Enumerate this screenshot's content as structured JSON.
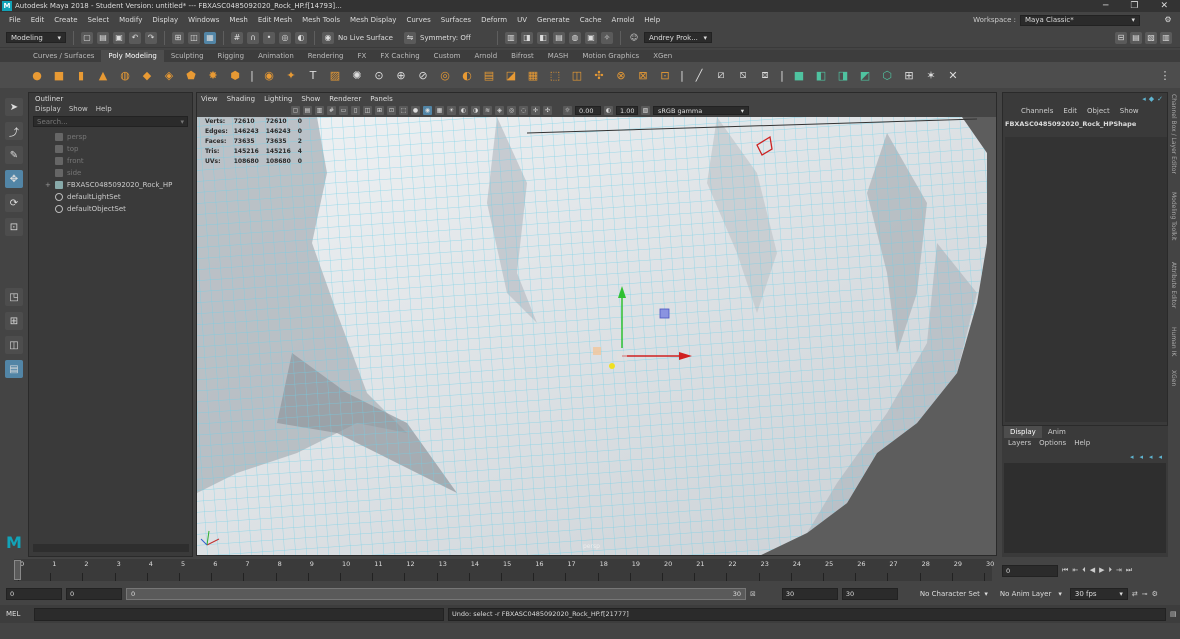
{
  "titlebar": {
    "title": "Autodesk Maya 2018 - Student Version: untitled*   ---   FBXASC0485092020_Rock_HP.f[14793]...",
    "controls": [
      "─",
      "❐",
      "✕"
    ]
  },
  "menubar": {
    "items": [
      "File",
      "Edit",
      "Create",
      "Select",
      "Modify",
      "Display",
      "Windows",
      "Mesh",
      "Edit Mesh",
      "Mesh Tools",
      "Mesh Display",
      "Curves",
      "Surfaces",
      "Deform",
      "UV",
      "Generate",
      "Cache",
      "Arnold",
      "Help"
    ],
    "workspace_label": "Workspace :",
    "workspace_value": "Maya Classic*"
  },
  "statusline": {
    "mode": "Modeling",
    "live_surface": "No Live Surface",
    "symmetry": "Symmetry: Off",
    "user": "Andrey Prok..."
  },
  "shelf": {
    "tabs": [
      "Curves / Surfaces",
      "Poly Modeling",
      "Sculpting",
      "Rigging",
      "Animation",
      "Rendering",
      "FX",
      "FX Caching",
      "Custom",
      "Arnold",
      "Bifrost",
      "MASH",
      "Motion Graphics",
      "XGen"
    ],
    "active_tab": "Poly Modeling"
  },
  "outliner": {
    "title": "Outliner",
    "menus": [
      "Display",
      "Show",
      "Help"
    ],
    "search_placeholder": "Search...",
    "items": [
      {
        "label": "persp",
        "dim": true
      },
      {
        "label": "top",
        "dim": true
      },
      {
        "label": "front",
        "dim": true
      },
      {
        "label": "side",
        "dim": true
      },
      {
        "label": "FBXASC0485092020_Rock_HP",
        "dim": false
      },
      {
        "label": "defaultLightSet",
        "dim": false
      },
      {
        "label": "defaultObjectSet",
        "dim": false
      }
    ]
  },
  "viewport": {
    "menus": [
      "View",
      "Shading",
      "Lighting",
      "Show",
      "Renderer",
      "Panels"
    ],
    "exposure": "0.00",
    "gamma": "1.00",
    "color_space": "sRGB gamma",
    "hud": [
      {
        "label": "Verts:",
        "a": "72610",
        "b": "72610",
        "c": "0"
      },
      {
        "label": "Edges:",
        "a": "146243",
        "b": "146243",
        "c": "0"
      },
      {
        "label": "Faces:",
        "a": "73635",
        "b": "73635",
        "c": "2"
      },
      {
        "label": "Tris:",
        "a": "145216",
        "b": "145216",
        "c": "4"
      },
      {
        "label": "UVs:",
        "a": "108680",
        "b": "108680",
        "c": "0"
      }
    ],
    "camera_label": "persp"
  },
  "channelbox": {
    "menus": [
      "Channels",
      "Edit",
      "Object",
      "Show"
    ],
    "node": "FBXASC0485092020_Rock_HPShape"
  },
  "layers": {
    "tabs": [
      "Display",
      "Anim"
    ],
    "menus": [
      "Layers",
      "Options",
      "Help"
    ]
  },
  "right_strip": [
    "Channel Box / Layer Editor",
    "Modeling Toolkit",
    "Attribute Editor",
    "Human IK",
    "XGen"
  ],
  "timeslider": {
    "current": "0",
    "labels": [
      "0",
      "1",
      "2",
      "3",
      "4",
      "5",
      "6",
      "7",
      "8",
      "9",
      "10",
      "11",
      "12",
      "13",
      "14",
      "15",
      "16",
      "17",
      "18",
      "19",
      "20",
      "21",
      "22",
      "23",
      "24",
      "25",
      "26",
      "27",
      "28",
      "29",
      "30"
    ],
    "frame_field": "0"
  },
  "range": {
    "start": "0",
    "start_inner": "0",
    "bar_start": "0",
    "bar_end": "30",
    "end_inner": "30",
    "end": "30",
    "character_set": "No Character Set",
    "anim_layer": "No Anim Layer",
    "fps": "30 fps"
  },
  "cmdline": {
    "lang": "MEL",
    "result": "Undo: select -r FBXASC0485092020_Rock_HP.f[21777]"
  },
  "colors": {
    "wire": "#6fd0e8",
    "mesh_light": "#e6eaee",
    "mesh_shadow": "#9aa1a8",
    "accent_orange": "#e89a34",
    "selected_blue": "#5285a6"
  }
}
